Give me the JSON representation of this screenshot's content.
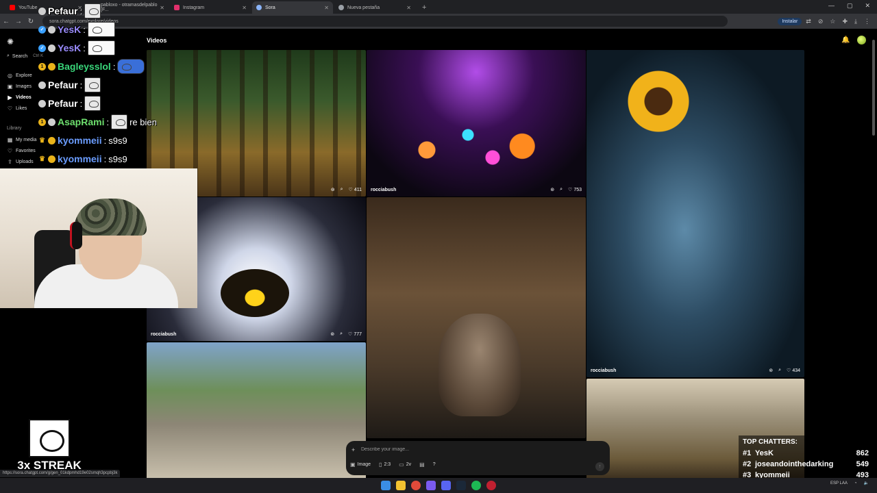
{
  "browser": {
    "tabs": [
      {
        "label": "YouTube",
        "color": "#ff0000",
        "active": false
      },
      {
        "label": "pabloxo - otramasdelpablo [F...",
        "color": "#9146ff",
        "active": false
      },
      {
        "label": "Instagram",
        "color": "#e1306c",
        "active": false
      },
      {
        "label": "Sora",
        "color": "#8ab4f8",
        "active": true
      },
      {
        "label": "Nueva pestaña",
        "color": "#9aa0a6",
        "active": false
      }
    ],
    "url": "sora.chatgpt.com/explore/videos",
    "install_label": "Instalar"
  },
  "sora": {
    "page_title": "Videos",
    "search_label": "Search",
    "search_shortcut": "Ctrl K",
    "nav": [
      "Explore",
      "Images",
      "Videos",
      "Likes"
    ],
    "library_heading": "Library",
    "library": [
      "My media",
      "Favorites",
      "Uploads"
    ],
    "tiles": [
      {
        "author": "",
        "likes": "411"
      },
      {
        "author": "rocciabush",
        "likes": "753"
      },
      {
        "author": "rocciabush",
        "likes": "434"
      },
      {
        "author": "rocciabush",
        "likes": "777"
      }
    ],
    "composer": {
      "placeholder": "Describe your image...",
      "mode": "Image",
      "ratio": "2:3",
      "variations": "2v",
      "help": "?"
    }
  },
  "stream": {
    "chat": [
      {
        "user": "Pefaur",
        "color": "#ffffff",
        "message": ""
      },
      {
        "user": "YesK",
        "color": "#9b8cff",
        "message": ""
      },
      {
        "user": "YesK",
        "color": "#9b8cff",
        "message": ""
      },
      {
        "user": "Bagleysslol",
        "color": "#39d67a",
        "message": ""
      },
      {
        "user": "Pefaur",
        "color": "#ffffff",
        "message": ""
      },
      {
        "user": "Pefaur",
        "color": "#ffffff",
        "message": ""
      },
      {
        "user": "AsapRami",
        "color": "#6ee06e",
        "message": "re bien"
      },
      {
        "user": "kyommeii",
        "color": "#6b9dff",
        "message": "s9s9"
      },
      {
        "user": "kyommeii",
        "color": "#6b9dff",
        "message": "s9s9"
      }
    ],
    "streak": "3x STREAK",
    "status_url": "https://sora.chatgpt.com/g/gen_01kdpmhd19e02smqh3pcpbj3k",
    "top_chatters_title": "TOP CHATTERS:",
    "top_chatters": [
      {
        "rank": "#1",
        "name": "YesK",
        "count": "862"
      },
      {
        "rank": "#2",
        "name": "joseandointhedarking",
        "count": "549"
      },
      {
        "rank": "#3",
        "name": "kyommeii",
        "count": "493"
      }
    ]
  },
  "taskbar": {
    "lang": "ESP",
    "region": "LAA"
  }
}
